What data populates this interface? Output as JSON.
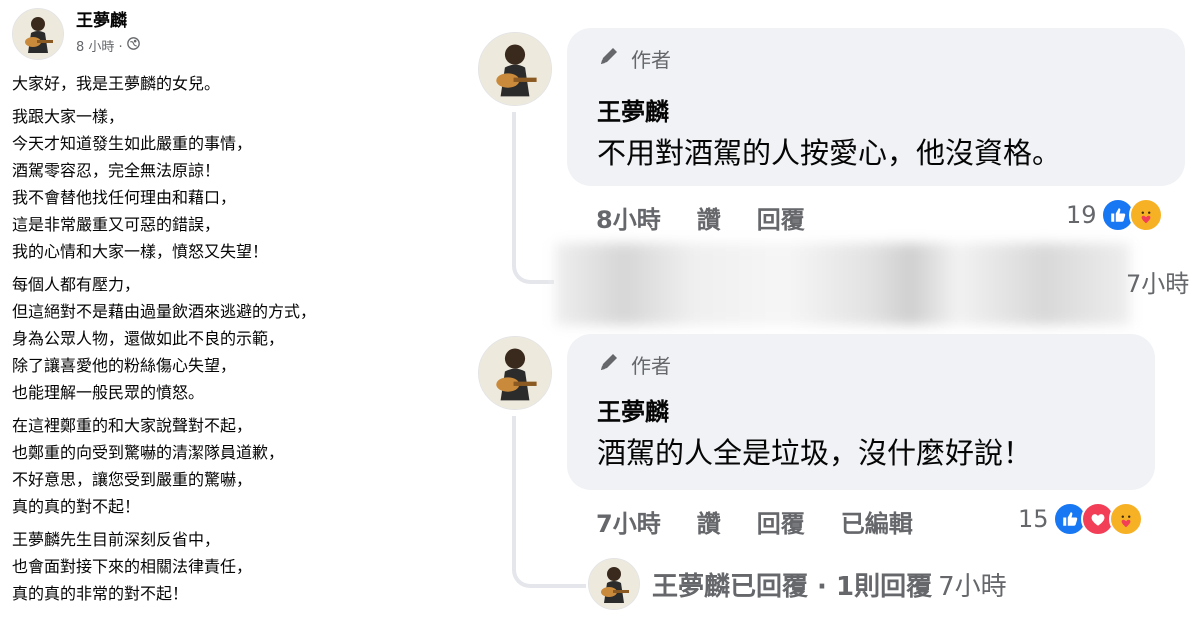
{
  "post": {
    "author": "王夢麟",
    "time": "8 小時 ·",
    "paragraphs": [
      [
        "大家好，我是王夢麟的女兒。"
      ],
      [
        "我跟大家一樣，",
        "今天才知道發生如此嚴重的事情，",
        "酒駕零容忍，完全無法原諒！",
        "我不會替他找任何理由和藉口，",
        "這是非常嚴重又可惡的錯誤，",
        "我的心情和大家一樣，憤怒又失望！"
      ],
      [
        "每個人都有壓力，",
        "但這絕對不是藉由過量飲酒來逃避的方式，",
        "身為公眾人物，還做如此不良的示範，",
        "除了讓喜愛他的粉絲傷心失望，",
        "也能理解一般民眾的憤怒。"
      ],
      [
        "在這裡鄭重的和大家說聲對不起，",
        "也鄭重的向受到驚嚇的清潔隊員道歉，",
        "不好意思，讓您受到嚴重的驚嚇，",
        "真的真的對不起！"
      ],
      [
        "王夢麟先生目前深刻反省中，",
        "也會面對接下來的相關法律責任，",
        "真的真的非常的對不起！"
      ]
    ]
  },
  "comments": [
    {
      "badge": "作者",
      "author": "王夢麟",
      "text": "不用對酒駕的人按愛心，他沒資格。",
      "time": "8小時",
      "like": "讚",
      "reply": "回覆",
      "reactions": "19"
    },
    {
      "badge": "作者",
      "author": "王夢麟",
      "text": "酒駕的人全是垃圾，沒什麼好說！",
      "time": "7小時",
      "like": "讚",
      "reply": "回覆",
      "edited": "已編輯",
      "reactions": "15"
    }
  ],
  "blurred_time": "7小時",
  "replies_summary": {
    "text": "王夢麟已回覆 · 1則回覆",
    "time": "7小時"
  },
  "colors": {
    "bubble": "#f0f2f5",
    "like_blue": "#1877f2",
    "love_red": "#f33e58",
    "care_yellow": "#f7b125",
    "meta_gray": "#65676b"
  }
}
